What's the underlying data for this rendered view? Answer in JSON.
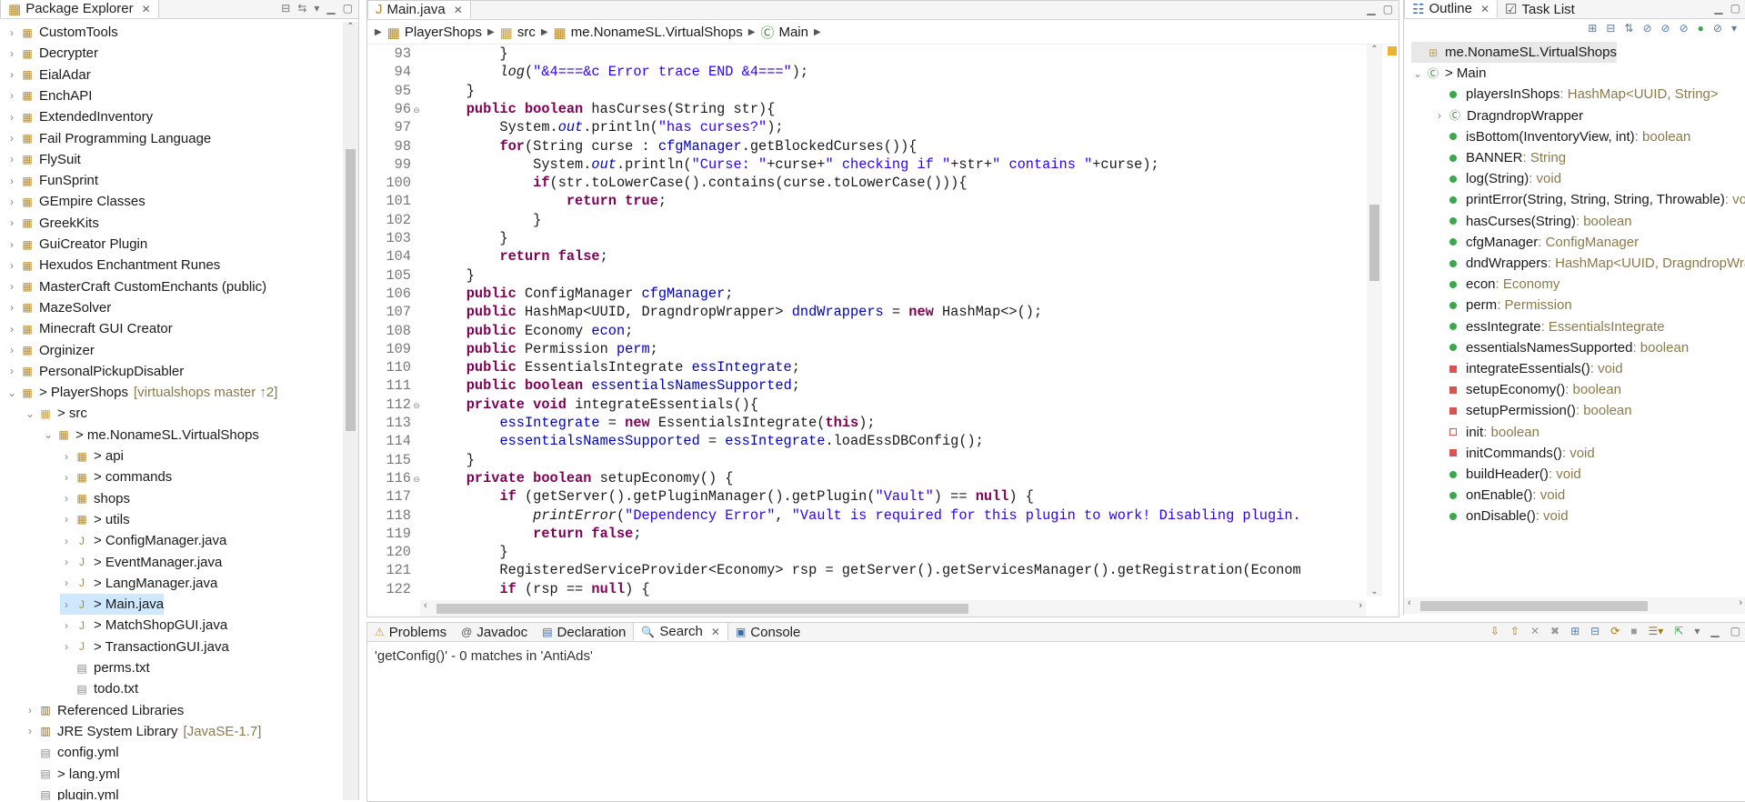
{
  "package_explorer": {
    "tab_label": "Package Explorer",
    "items": [
      {
        "label": "CustomTools",
        "level": 0,
        "arrow": "›",
        "icon": "project"
      },
      {
        "label": "Decrypter",
        "level": 0,
        "arrow": "›",
        "icon": "project"
      },
      {
        "label": "EialAdar",
        "level": 0,
        "arrow": "›",
        "icon": "project"
      },
      {
        "label": "EnchAPI",
        "level": 0,
        "arrow": "›",
        "icon": "project"
      },
      {
        "label": "ExtendedInventory",
        "level": 0,
        "arrow": "›",
        "icon": "project"
      },
      {
        "label": "Fail Programming Language",
        "level": 0,
        "arrow": "›",
        "icon": "project"
      },
      {
        "label": "FlySuit",
        "level": 0,
        "arrow": "›",
        "icon": "project"
      },
      {
        "label": "FunSprint",
        "level": 0,
        "arrow": "›",
        "icon": "project"
      },
      {
        "label": "GEmpire Classes",
        "level": 0,
        "arrow": "›",
        "icon": "project"
      },
      {
        "label": "GreekKits",
        "level": 0,
        "arrow": "›",
        "icon": "project"
      },
      {
        "label": "GuiCreator Plugin",
        "level": 0,
        "arrow": "›",
        "icon": "project"
      },
      {
        "label": "Hexudos Enchantment Runes",
        "level": 0,
        "arrow": "›",
        "icon": "project"
      },
      {
        "label": "MasterCraft CustomEnchants (public)",
        "level": 0,
        "arrow": "›",
        "icon": "project"
      },
      {
        "label": "MazeSolver",
        "level": 0,
        "arrow": "›",
        "icon": "project"
      },
      {
        "label": "Minecraft GUI Creator",
        "level": 0,
        "arrow": "›",
        "icon": "project"
      },
      {
        "label": "Orginizer",
        "level": 0,
        "arrow": "›",
        "icon": "project"
      },
      {
        "label": "PersonalPickupDisabler",
        "level": 0,
        "arrow": "›",
        "icon": "project"
      },
      {
        "label": "> PlayerShops",
        "level": 0,
        "arrow": "⌄",
        "icon": "project",
        "deco": "[virtualshops master ↑2]"
      },
      {
        "label": "> src",
        "level": 1,
        "arrow": "⌄",
        "icon": "folder"
      },
      {
        "label": "> me.NonameSL.VirtualShops",
        "level": 2,
        "arrow": "⌄",
        "icon": "package"
      },
      {
        "label": "> api",
        "level": 3,
        "arrow": "›",
        "icon": "package"
      },
      {
        "label": "> commands",
        "level": 3,
        "arrow": "›",
        "icon": "package"
      },
      {
        "label": "shops",
        "level": 3,
        "arrow": "›",
        "icon": "package"
      },
      {
        "label": "> utils",
        "level": 3,
        "arrow": "›",
        "icon": "package"
      },
      {
        "label": "> ConfigManager.java",
        "level": 3,
        "arrow": "›",
        "icon": "java"
      },
      {
        "label": "> EventManager.java",
        "level": 3,
        "arrow": "›",
        "icon": "java"
      },
      {
        "label": "> LangManager.java",
        "level": 3,
        "arrow": "›",
        "icon": "java"
      },
      {
        "label": "> Main.java",
        "level": 3,
        "arrow": "›",
        "icon": "java",
        "selected": true
      },
      {
        "label": "> MatchShopGUI.java",
        "level": 3,
        "arrow": "›",
        "icon": "java"
      },
      {
        "label": "> TransactionGUI.java",
        "level": 3,
        "arrow": "›",
        "icon": "java"
      },
      {
        "label": "perms.txt",
        "level": 3,
        "arrow": "",
        "icon": "file"
      },
      {
        "label": "todo.txt",
        "level": 3,
        "arrow": "",
        "icon": "file"
      },
      {
        "label": "Referenced Libraries",
        "level": 1,
        "arrow": "›",
        "icon": "library"
      },
      {
        "label": "JRE System Library",
        "level": 1,
        "arrow": "›",
        "icon": "library",
        "deco": "[JavaSE-1.7]"
      },
      {
        "label": "config.yml",
        "level": 1,
        "arrow": "",
        "icon": "file"
      },
      {
        "label": "> lang.yml",
        "level": 1,
        "arrow": "",
        "icon": "file"
      },
      {
        "label": "plugin.yml",
        "level": 1,
        "arrow": "",
        "icon": "file"
      }
    ]
  },
  "editor": {
    "tab_label": "Main.java",
    "breadcrumbs": [
      "PlayerShops",
      "src",
      "me.NonameSL.VirtualShops",
      "Main"
    ],
    "lines": [
      {
        "n": "93",
        "fold": "",
        "html": "        }"
      },
      {
        "n": "94",
        "fold": "",
        "html": "        <span class=\"it\">log</span>(<span class=\"str\">\"&amp;4===&amp;c Error trace END &amp;4===\"</span>);"
      },
      {
        "n": "95",
        "fold": "",
        "html": "    }"
      },
      {
        "n": "96",
        "fold": "⊖",
        "html": "    <span class=\"kw\">public</span> <span class=\"kw\">boolean</span> hasCurses(String str){"
      },
      {
        "n": "97",
        "fold": "",
        "html": "        System.<span class=\"fld it\">out</span>.println(<span class=\"str\">\"has curses?\"</span>);"
      },
      {
        "n": "98",
        "fold": "",
        "html": "        <span class=\"kw\">for</span>(String curse : <span class=\"fld\">cfgManager</span>.getBlockedCurses()){"
      },
      {
        "n": "99",
        "fold": "",
        "html": "            System.<span class=\"fld it\">out</span>.println(<span class=\"str\">\"Curse: \"</span>+curse+<span class=\"str\">\" checking if \"</span>+str+<span class=\"str\">\" contains \"</span>+curse);"
      },
      {
        "n": "100",
        "fold": "",
        "html": "            <span class=\"kw\">if</span>(str.toLowerCase().contains(curse.toLowerCase())){"
      },
      {
        "n": "101",
        "fold": "",
        "html": "                <span class=\"kw\">return</span> <span class=\"kw\">true</span>;"
      },
      {
        "n": "102",
        "fold": "",
        "html": "            }"
      },
      {
        "n": "103",
        "fold": "",
        "html": "        }"
      },
      {
        "n": "104",
        "fold": "",
        "html": "        <span class=\"kw\">return</span> <span class=\"kw\">false</span>;"
      },
      {
        "n": "105",
        "fold": "",
        "html": "    }"
      },
      {
        "n": "106",
        "fold": "",
        "html": "    <span class=\"kw\">public</span> ConfigManager <span class=\"fld\">cfgManager</span>;"
      },
      {
        "n": "107",
        "fold": "",
        "html": "    <span class=\"kw\">public</span> HashMap&lt;UUID, DragndropWrapper&gt; <span class=\"fld\">dndWrappers</span> = <span class=\"kw\">new</span> HashMap&lt;&gt;();"
      },
      {
        "n": "108",
        "fold": "",
        "html": "    <span class=\"kw\">public</span> Economy <span class=\"fld\">econ</span>;"
      },
      {
        "n": "109",
        "fold": "",
        "html": "    <span class=\"kw\">public</span> Permission <span class=\"fld\">perm</span>;"
      },
      {
        "n": "110",
        "fold": "",
        "html": "    <span class=\"kw\">public</span> EssentialsIntegrate <span class=\"fld\">essIntegrate</span>;"
      },
      {
        "n": "111",
        "fold": "",
        "html": "    <span class=\"kw\">public</span> <span class=\"kw\">boolean</span> <span class=\"fld\">essentialsNamesSupported</span>;"
      },
      {
        "n": "112",
        "fold": "⊖",
        "html": "    <span class=\"kw\">private</span> <span class=\"kw\">void</span> integrateEssentials(){"
      },
      {
        "n": "113",
        "fold": "",
        "html": "        <span class=\"fld\">essIntegrate</span> = <span class=\"kw\">new</span> EssentialsIntegrate(<span class=\"kw\">this</span>);"
      },
      {
        "n": "114",
        "fold": "",
        "html": "        <span class=\"fld\">essentialsNamesSupported</span> = <span class=\"fld\">essIntegrate</span>.loadEssDBConfig();"
      },
      {
        "n": "115",
        "fold": "",
        "html": "    }"
      },
      {
        "n": "116",
        "fold": "⊖",
        "html": "    <span class=\"kw\">private</span> <span class=\"kw\">boolean</span> setupEconomy() {"
      },
      {
        "n": "117",
        "fold": "",
        "html": "        <span class=\"kw\">if</span> (getServer().getPluginManager().getPlugin(<span class=\"str\">\"Vault\"</span>) == <span class=\"kw\">null</span>) {"
      },
      {
        "n": "118",
        "fold": "",
        "html": "            <span class=\"it\">printError</span>(<span class=\"str\">\"Dependency Error\"</span>, <span class=\"str\">\"Vault is required for this plugin to work! Disabling plugin.</span>"
      },
      {
        "n": "119",
        "fold": "",
        "html": "            <span class=\"kw\">return</span> <span class=\"kw\">false</span>;"
      },
      {
        "n": "120",
        "fold": "",
        "html": "        }"
      },
      {
        "n": "121",
        "fold": "",
        "html": "        RegisteredServiceProvider&lt;Economy&gt; rsp = getServer().getServicesManager().getRegistration(Econom"
      },
      {
        "n": "122",
        "fold": "",
        "html": "        <span class=\"kw\">if</span> (rsp == <span class=\"kw\">null</span>) {"
      }
    ]
  },
  "outline": {
    "tab_label": "Outline",
    "tasklist_label": "Task List",
    "items": [
      {
        "label": "me.NonameSL.VirtualShops",
        "type": "",
        "level": 0,
        "icon": "package",
        "color": "#b9a35a",
        "arrow": ""
      },
      {
        "label": "> Main",
        "type": "",
        "level": 0,
        "icon": "class",
        "color": "#3a8a3a",
        "arrow": "⌄"
      },
      {
        "label": "playersInShops",
        "type": " : HashMap<UUID, String>",
        "level": 1,
        "icon": "dot",
        "color": "#3aa84a",
        "arrow": ""
      },
      {
        "label": "DragndropWrapper",
        "type": "",
        "level": 1,
        "icon": "class",
        "color": "#3a8a3a",
        "arrow": "›"
      },
      {
        "label": "isBottom(InventoryView, int)",
        "type": " : boolean",
        "level": 1,
        "icon": "dot",
        "color": "#3aa84a",
        "arrow": ""
      },
      {
        "label": "BANNER",
        "type": " : String",
        "level": 1,
        "icon": "dot",
        "color": "#3aa84a",
        "arrow": ""
      },
      {
        "label": "log(String)",
        "type": " : void",
        "level": 1,
        "icon": "dot",
        "color": "#3aa84a",
        "arrow": ""
      },
      {
        "label": "printError(String, String, String, Throwable)",
        "type": " : void",
        "level": 1,
        "icon": "dot",
        "color": "#3aa84a",
        "arrow": ""
      },
      {
        "label": "hasCurses(String)",
        "type": " : boolean",
        "level": 1,
        "icon": "dot",
        "color": "#3aa84a",
        "arrow": ""
      },
      {
        "label": "cfgManager",
        "type": " : ConfigManager",
        "level": 1,
        "icon": "dot",
        "color": "#3aa84a",
        "arrow": ""
      },
      {
        "label": "dndWrappers",
        "type": " : HashMap<UUID, DragndropWrapper>",
        "level": 1,
        "icon": "dot",
        "color": "#3aa84a",
        "arrow": ""
      },
      {
        "label": "econ",
        "type": " : Economy",
        "level": 1,
        "icon": "dot",
        "color": "#3aa84a",
        "arrow": ""
      },
      {
        "label": "perm",
        "type": " : Permission",
        "level": 1,
        "icon": "dot",
        "color": "#3aa84a",
        "arrow": ""
      },
      {
        "label": "essIntegrate",
        "type": " : EssentialsIntegrate",
        "level": 1,
        "icon": "dot",
        "color": "#3aa84a",
        "arrow": ""
      },
      {
        "label": "essentialsNamesSupported",
        "type": " : boolean",
        "level": 1,
        "icon": "dot",
        "color": "#3aa84a",
        "arrow": ""
      },
      {
        "label": "integrateEssentials()",
        "type": " : void",
        "level": 1,
        "icon": "square",
        "color": "#d9534f",
        "arrow": ""
      },
      {
        "label": "setupEconomy()",
        "type": " : boolean",
        "level": 1,
        "icon": "square",
        "color": "#d9534f",
        "arrow": ""
      },
      {
        "label": "setupPermission()",
        "type": " : boolean",
        "level": 1,
        "icon": "square",
        "color": "#d9534f",
        "arrow": ""
      },
      {
        "label": "init",
        "type": " : boolean",
        "level": 1,
        "icon": "square-outline",
        "color": "#d9534f",
        "arrow": ""
      },
      {
        "label": "initCommands()",
        "type": " : void",
        "level": 1,
        "icon": "square",
        "color": "#d9534f",
        "arrow": ""
      },
      {
        "label": "buildHeader()",
        "type": " : void",
        "level": 1,
        "icon": "dot",
        "color": "#3aa84a",
        "arrow": ""
      },
      {
        "label": "onEnable()",
        "type": " : void",
        "level": 1,
        "icon": "dot",
        "color": "#3aa84a",
        "arrow": ""
      },
      {
        "label": "onDisable()",
        "type": " : void",
        "level": 1,
        "icon": "dot",
        "color": "#3aa84a",
        "arrow": ""
      }
    ]
  },
  "bottom_panel": {
    "tabs": [
      "Problems",
      "Javadoc",
      "Declaration",
      "Search",
      "Console"
    ],
    "active_tab": "Search",
    "result_text": "'getConfig()' - 0 matches in 'AntiAds'"
  }
}
